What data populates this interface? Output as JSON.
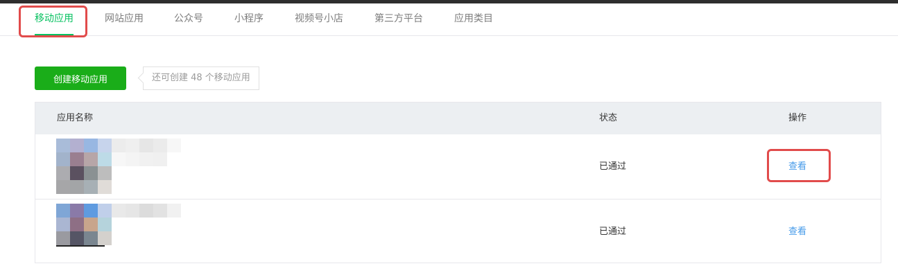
{
  "tabs": [
    {
      "label": "移动应用",
      "active": true
    },
    {
      "label": "网站应用",
      "active": false
    },
    {
      "label": "公众号",
      "active": false
    },
    {
      "label": "小程序",
      "active": false
    },
    {
      "label": "视频号小店",
      "active": false
    },
    {
      "label": "第三方平台",
      "active": false
    },
    {
      "label": "应用类目",
      "active": false
    }
  ],
  "actions": {
    "create_button": "创建移动应用",
    "quota_text": "还可创建 48 个移动应用"
  },
  "table": {
    "headers": {
      "name": "应用名称",
      "status": "状态",
      "ops": "操作"
    },
    "rows": [
      {
        "name_icon": "blurred-app-icon",
        "status": "已通过",
        "action": "查看"
      },
      {
        "name_icon": "blurred-app-icon",
        "status": "已通过",
        "action": "查看"
      }
    ]
  },
  "colors": {
    "accent": "#07c160",
    "button": "#1aad19",
    "link": "#459ae9",
    "highlight": "#e14b4b",
    "header_bg": "#eceff2"
  }
}
